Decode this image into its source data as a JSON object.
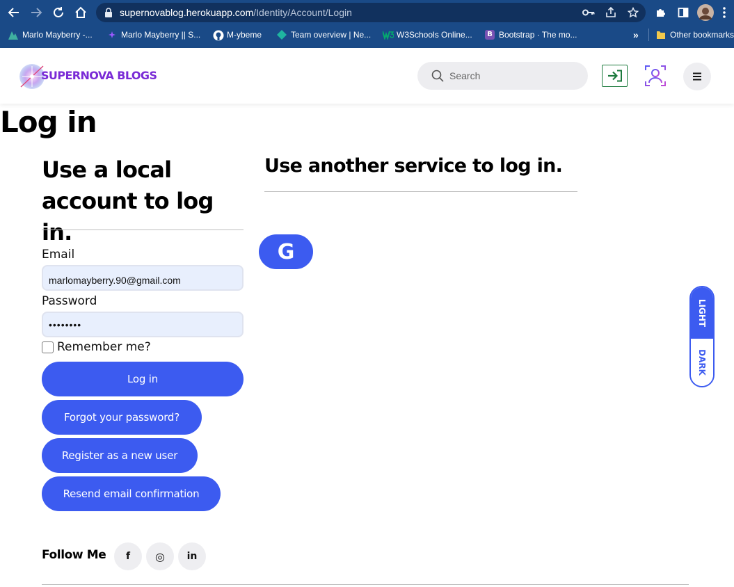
{
  "browser": {
    "url_host": "supernovablog.herokuapp.com",
    "url_path": "/Identity/Account/Login",
    "overflow_label": "»",
    "bookmarks": [
      {
        "label": "Marlo Mayberry -...",
        "icon": "mountain-icon",
        "color": "#3fb0a0"
      },
      {
        "label": "Marlo Mayberry || S...",
        "icon": "sparkle-icon",
        "color": "#9b59ff"
      },
      {
        "label": "M-ybeme",
        "icon": "github-icon",
        "color": "#ffffff"
      },
      {
        "label": "Team overview | Ne...",
        "icon": "diamond-icon",
        "color": "#1fb5a0"
      },
      {
        "label": "W3Schools Online...",
        "icon": "w3schools-icon",
        "color": "#04aa6d"
      },
      {
        "label": "Bootstrap · The mo...",
        "icon": "bootstrap-icon",
        "color": "#7952b3"
      }
    ],
    "other_bookmarks": "Other bookmarks"
  },
  "header": {
    "logo_text": "SUPERNOVA BLOGS",
    "search_placeholder": "Search",
    "accent": "#3c5bf0",
    "logo_color": "#7a2bd6"
  },
  "main": {
    "page_title": "Log in",
    "local_heading": "Use a local account to log in.",
    "email_label": "Email",
    "email_value": "marlomayberry.90@gmail.com",
    "password_label": "Password",
    "password_value": "••••••••",
    "remember_label": "Remember me?",
    "login_button": "Log in",
    "forgot_button": "Forgot your password?",
    "register_button": "Register as a new user",
    "resend_button": "Resend email confirmation",
    "other_heading": "Use another service to log in.",
    "google_label": "G"
  },
  "theme": {
    "light": "LIGHT",
    "dark": "DARK"
  },
  "footer": {
    "follow_label": "Follow Me",
    "social": [
      {
        "label": "f",
        "icon": "facebook-icon"
      },
      {
        "label": "◎",
        "icon": "instagram-icon"
      },
      {
        "label": "in",
        "icon": "linkedin-icon"
      }
    ]
  }
}
